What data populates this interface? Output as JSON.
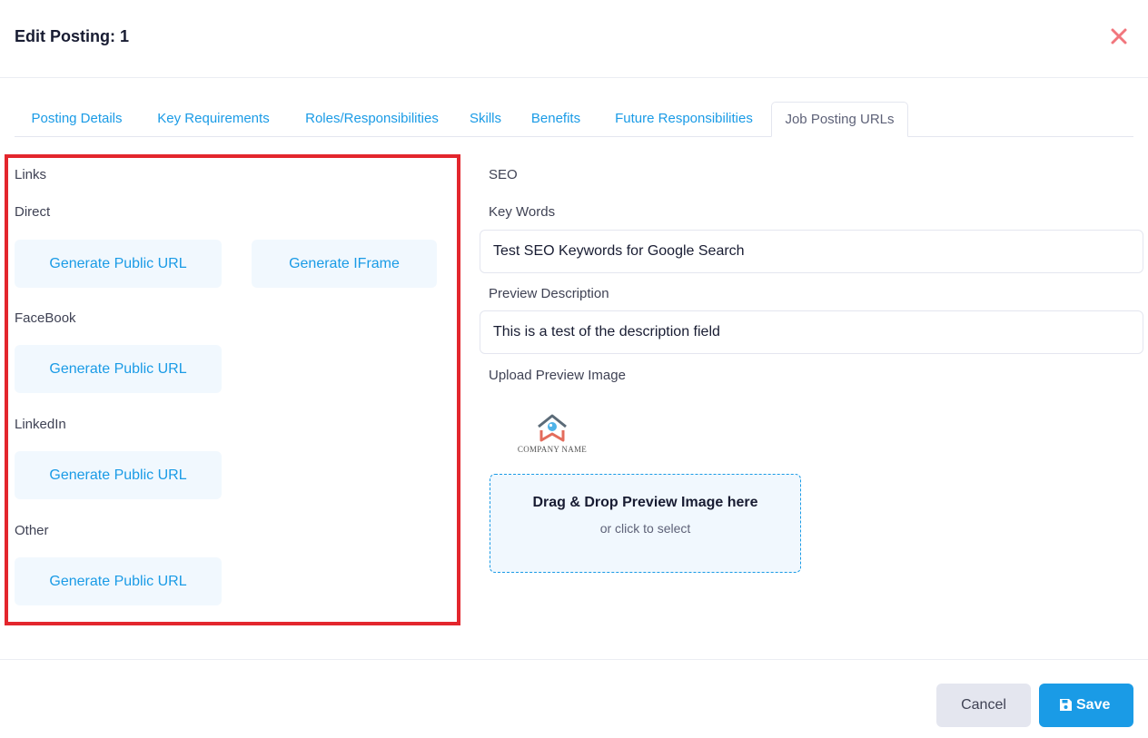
{
  "modal": {
    "title": "Edit Posting: 1",
    "colors": {
      "accent": "#1a9be6",
      "close": "#f1767d",
      "highlight_border": "#e3262d"
    }
  },
  "tabs": [
    {
      "label": "Posting Details",
      "active": false
    },
    {
      "label": "Key Requirements",
      "active": false
    },
    {
      "label": "Roles/Responsibilities",
      "active": false
    },
    {
      "label": "Skills",
      "active": false
    },
    {
      "label": "Benefits",
      "active": false
    },
    {
      "label": "Future Responsibilities",
      "active": false
    },
    {
      "label": "Job Posting URLs",
      "active": true
    }
  ],
  "links": {
    "heading": "Links",
    "direct": {
      "label": "Direct",
      "public_url_button": "Generate Public URL",
      "iframe_button": "Generate IFrame"
    },
    "facebook": {
      "label": "FaceBook",
      "public_url_button": "Generate Public URL"
    },
    "linkedin": {
      "label": "LinkedIn",
      "public_url_button": "Generate Public URL"
    },
    "other": {
      "label": "Other",
      "public_url_button": "Generate Public URL"
    }
  },
  "seo": {
    "heading": "SEO",
    "keywords_label": "Key Words",
    "keywords_value": "Test SEO Keywords  for Google Search",
    "description_label": "Preview Description",
    "description_value": "This is a test of the description field",
    "upload_label": "Upload Preview Image",
    "logo_text": "COMPANY NAME",
    "dropzone_title": "Drag & Drop Preview Image here",
    "dropzone_subtitle": "or click to select"
  },
  "footer": {
    "cancel_label": "Cancel",
    "save_label": "Save",
    "save_icon": "floppy-disk-icon",
    "close_icon": "close-icon"
  }
}
